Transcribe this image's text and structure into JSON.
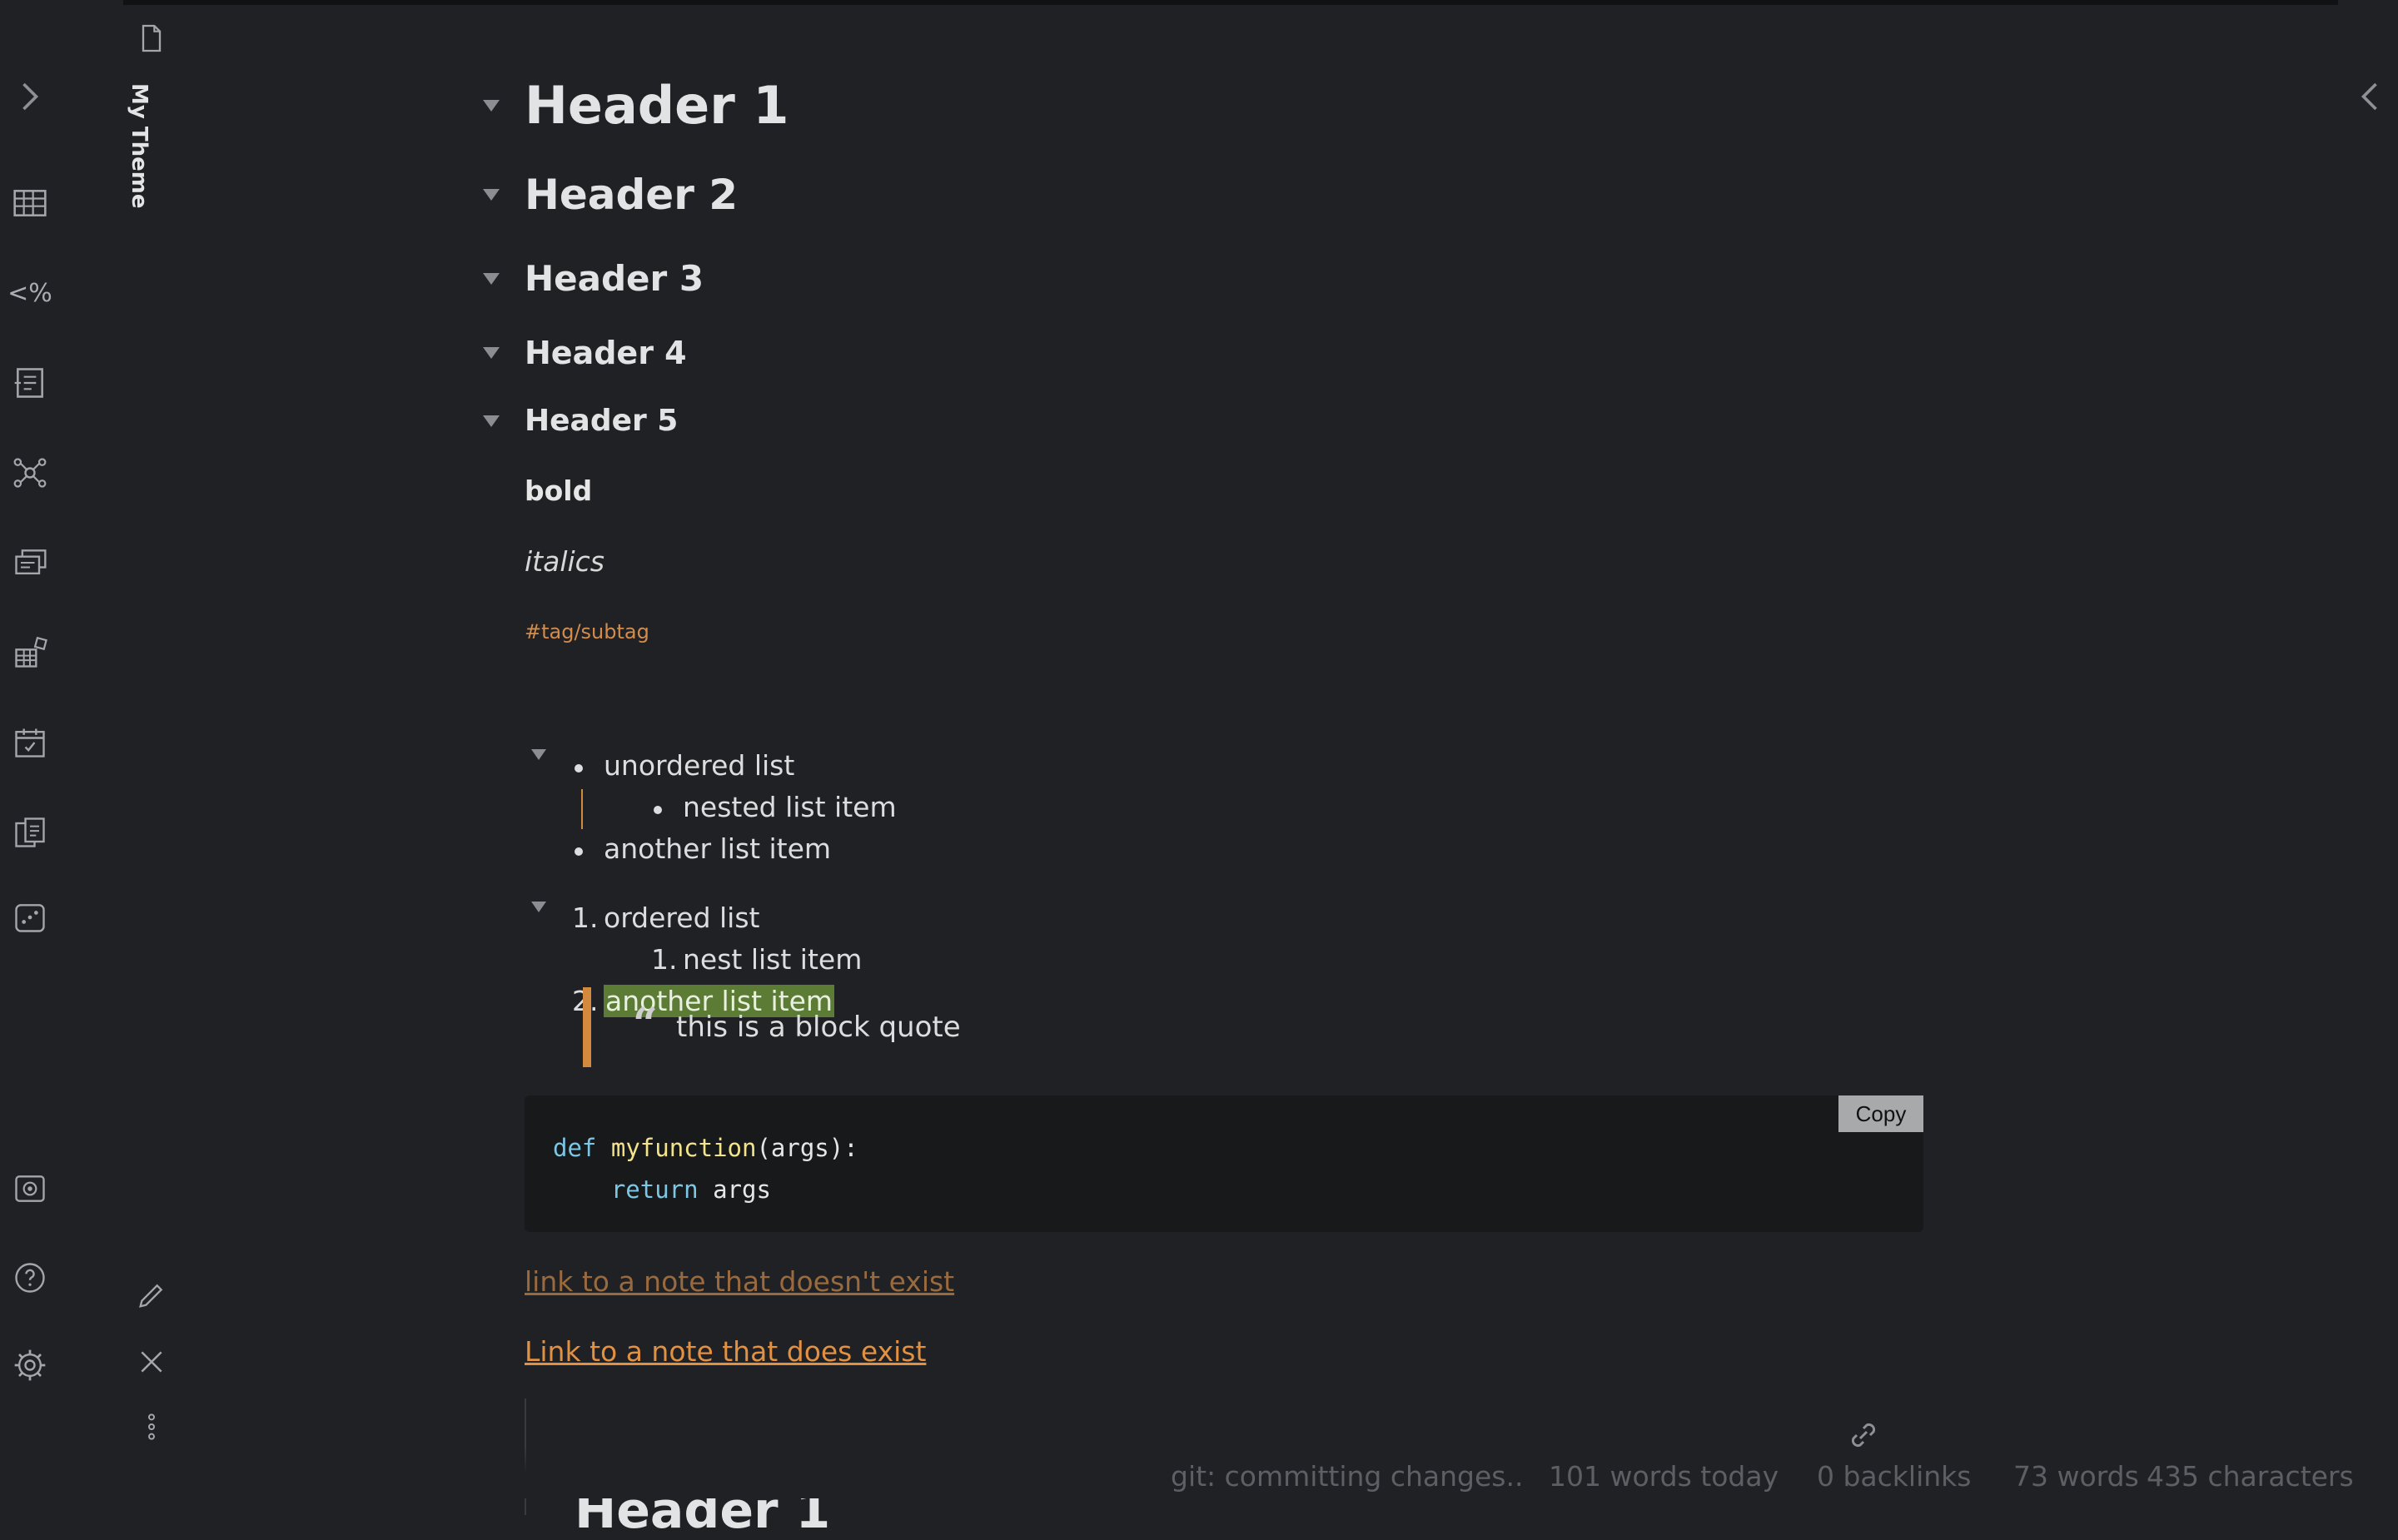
{
  "sidebar": {
    "tab_label": "My Theme",
    "ribbon_icons": [
      "table-icon",
      "templater-icon",
      "outline-icon",
      "graph-icon",
      "cards-icon",
      "kanban-icon",
      "calendar-icon",
      "copy-icon",
      "dice-icon"
    ],
    "ribbon_text": "<%"
  },
  "headings": {
    "h1": "Header 1",
    "h2": "Header 2",
    "h3": "Header 3",
    "h4": "Header 4",
    "h5": "Header 5"
  },
  "body": {
    "bold": "bold",
    "italic": "italics",
    "tag": "#tag/subtag"
  },
  "unordered_list": {
    "item1": "unordered list",
    "nested": "nested list item",
    "item2": "another list item"
  },
  "ordered_list": {
    "num1": "1.",
    "item1": "ordered list",
    "nested_num": "1.",
    "nested": "nest list item",
    "num2": "2.",
    "item2": "another list item"
  },
  "quote": {
    "mark": "“",
    "text": "this is a block quote"
  },
  "code": {
    "copy_label": "Copy",
    "kw_def": "def",
    "fn_name": "myfunction",
    "sig_rest": "(args):",
    "indent": "    ",
    "kw_return": "return",
    "ret_rest": " args"
  },
  "links": {
    "missing": "link to a note that doesn't exist",
    "exists": "Link to a note that does exist"
  },
  "embed": {
    "heading": "Header 1"
  },
  "status_bar": {
    "git": "git: committing changes..",
    "words_today": "101 words today",
    "backlinks": "0 backlinks",
    "words": "73 words",
    "characters": "435 characters"
  },
  "colors": {
    "accent": "#d4893f",
    "highlight": "#5c7c36",
    "background": "#202124"
  }
}
